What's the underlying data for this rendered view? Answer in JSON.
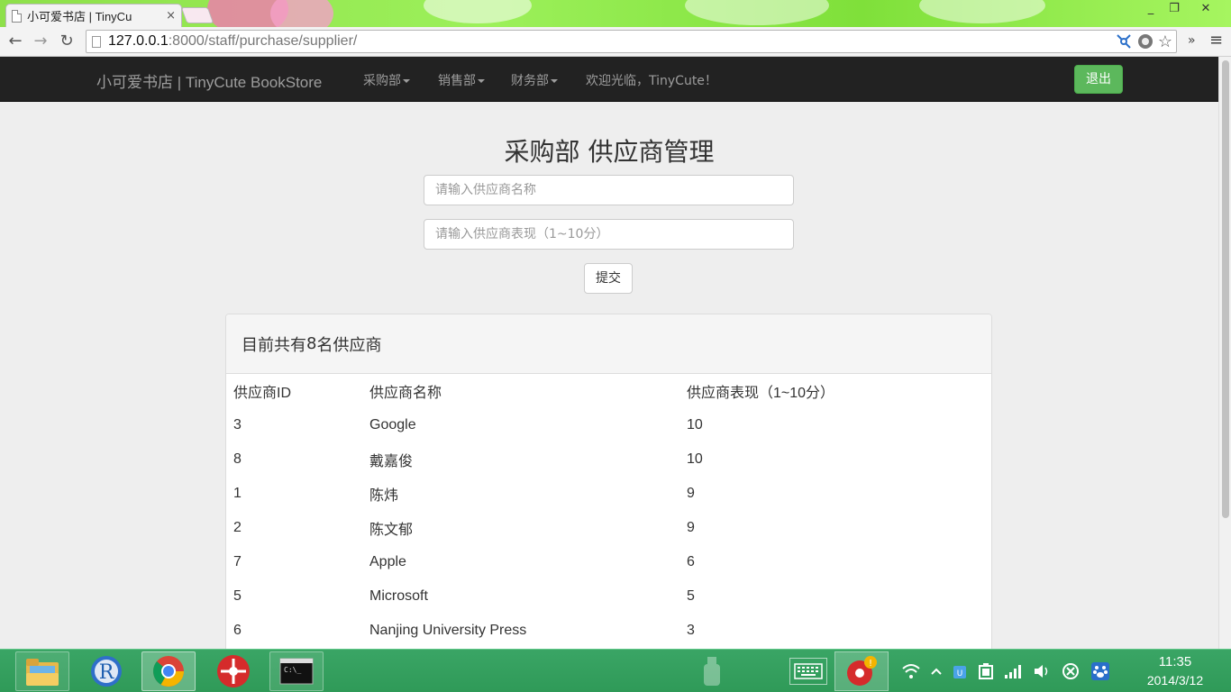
{
  "browser": {
    "tab_title": "小可爱书店 | TinyCu",
    "tab_close": "×",
    "url_host": "127.0.0.1",
    "url_rest": ":8000/staff/purchase/supplier/",
    "back_glyph": "←",
    "forward_glyph": "→",
    "reload_glyph": "↻",
    "star_glyph": "☆",
    "more_glyph": "»",
    "menu_glyph": "≡",
    "minimize_glyph": "_",
    "restore_glyph": "❐",
    "close_glyph": "✕"
  },
  "navbar": {
    "brand": "小可爱书店 | TinyCute BookStore",
    "items": [
      {
        "label": "采购部"
      },
      {
        "label": "销售部"
      },
      {
        "label": "财务部"
      }
    ],
    "welcome": "欢迎光临，TinyCute！",
    "logout_label": "退出"
  },
  "form": {
    "title": "采购部 供应商管理",
    "name_placeholder": "请输入供应商名称",
    "score_placeholder": "请输入供应商表现（1~10分）",
    "submit_label": "提交"
  },
  "panel": {
    "heading_prefix": "目前共有",
    "heading_count": "8",
    "heading_suffix": "名供应商",
    "columns": [
      "供应商ID",
      "供应商名称",
      "供应商表现（1~10分）"
    ],
    "rows": [
      [
        "3",
        "Google",
        "10"
      ],
      [
        "8",
        "戴嘉俊",
        "10"
      ],
      [
        "1",
        "陈炜",
        "9"
      ],
      [
        "2",
        "陈文郁",
        "9"
      ],
      [
        "7",
        "Apple",
        "6"
      ],
      [
        "5",
        "Microsoft",
        "5"
      ],
      [
        "6",
        "Nanjing University Press",
        "3"
      ]
    ]
  },
  "taskbar": {
    "time": "11:35",
    "date": "2014/3/12"
  },
  "colors": {
    "navbar_bg": "#222222",
    "logout_bg": "#5cb85c",
    "taskbar_bg": "#2f9a58",
    "tabbar_bg": "#8ee04a"
  }
}
